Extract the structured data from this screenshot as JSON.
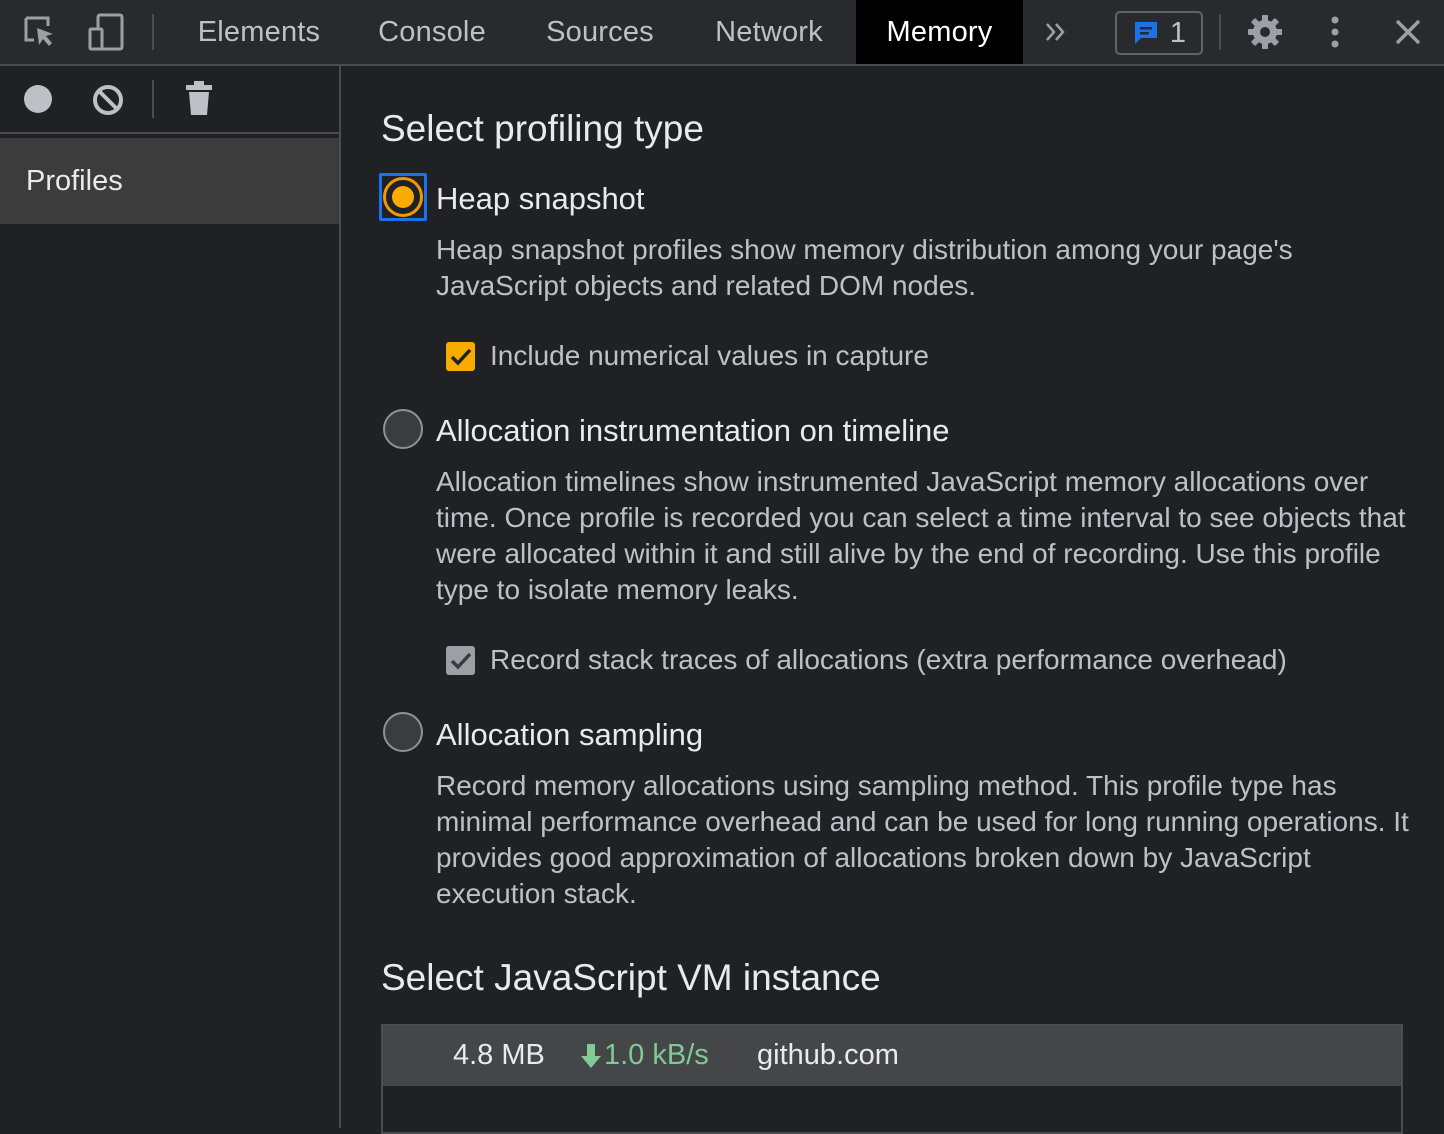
{
  "toolbar": {
    "tabs": [
      {
        "label": "Elements"
      },
      {
        "label": "Console"
      },
      {
        "label": "Sources"
      },
      {
        "label": "Network"
      },
      {
        "label": "Memory",
        "active": true
      }
    ],
    "issues_count": "1",
    "icons": {
      "inspect": "inspect-element-icon",
      "device": "device-toolbar-icon",
      "more_tabs": "chevron-double-right-icon",
      "issues": "message-icon",
      "settings": "gear-icon",
      "more": "kebab-menu-icon",
      "close": "close-icon"
    }
  },
  "sidebar": {
    "tools": [
      "record-icon",
      "clear-icon",
      "trash-icon"
    ],
    "items": [
      {
        "label": "Profiles",
        "selected": true
      }
    ]
  },
  "main": {
    "profiling_heading": "Select profiling type",
    "options": [
      {
        "label": "Heap snapshot",
        "checked": true,
        "description": "Heap snapshot profiles show memory distribution among your page's JavaScript objects and related DOM nodes.",
        "checkbox": {
          "label": "Include numerical values in capture",
          "checked": true
        }
      },
      {
        "label": "Allocation instrumentation on timeline",
        "checked": false,
        "description": "Allocation timelines show instrumented JavaScript memory allocations over time. Once profile is recorded you can select a time interval to see objects that were allocated within it and still alive by the end of recording. Use this profile type to isolate memory leaks.",
        "checkbox": {
          "label": "Record stack traces of allocations (extra performance overhead)",
          "checked": true,
          "disabled": true
        }
      },
      {
        "label": "Allocation sampling",
        "checked": false,
        "description": "Record memory allocations using sampling method. This profile type has minimal performance overhead and can be used for long running operations. It provides good approximation of allocations broken down by JavaScript execution stack."
      }
    ],
    "vm_heading": "Select JavaScript VM instance",
    "vm_instances": [
      {
        "size": "4.8 MB",
        "rate": "1.0 kB/s",
        "host": "github.com"
      }
    ]
  },
  "colors": {
    "accent": "#f9ab00",
    "focus": "#1a73e8",
    "rate": "#81c995",
    "issues": "#1a73e8"
  }
}
